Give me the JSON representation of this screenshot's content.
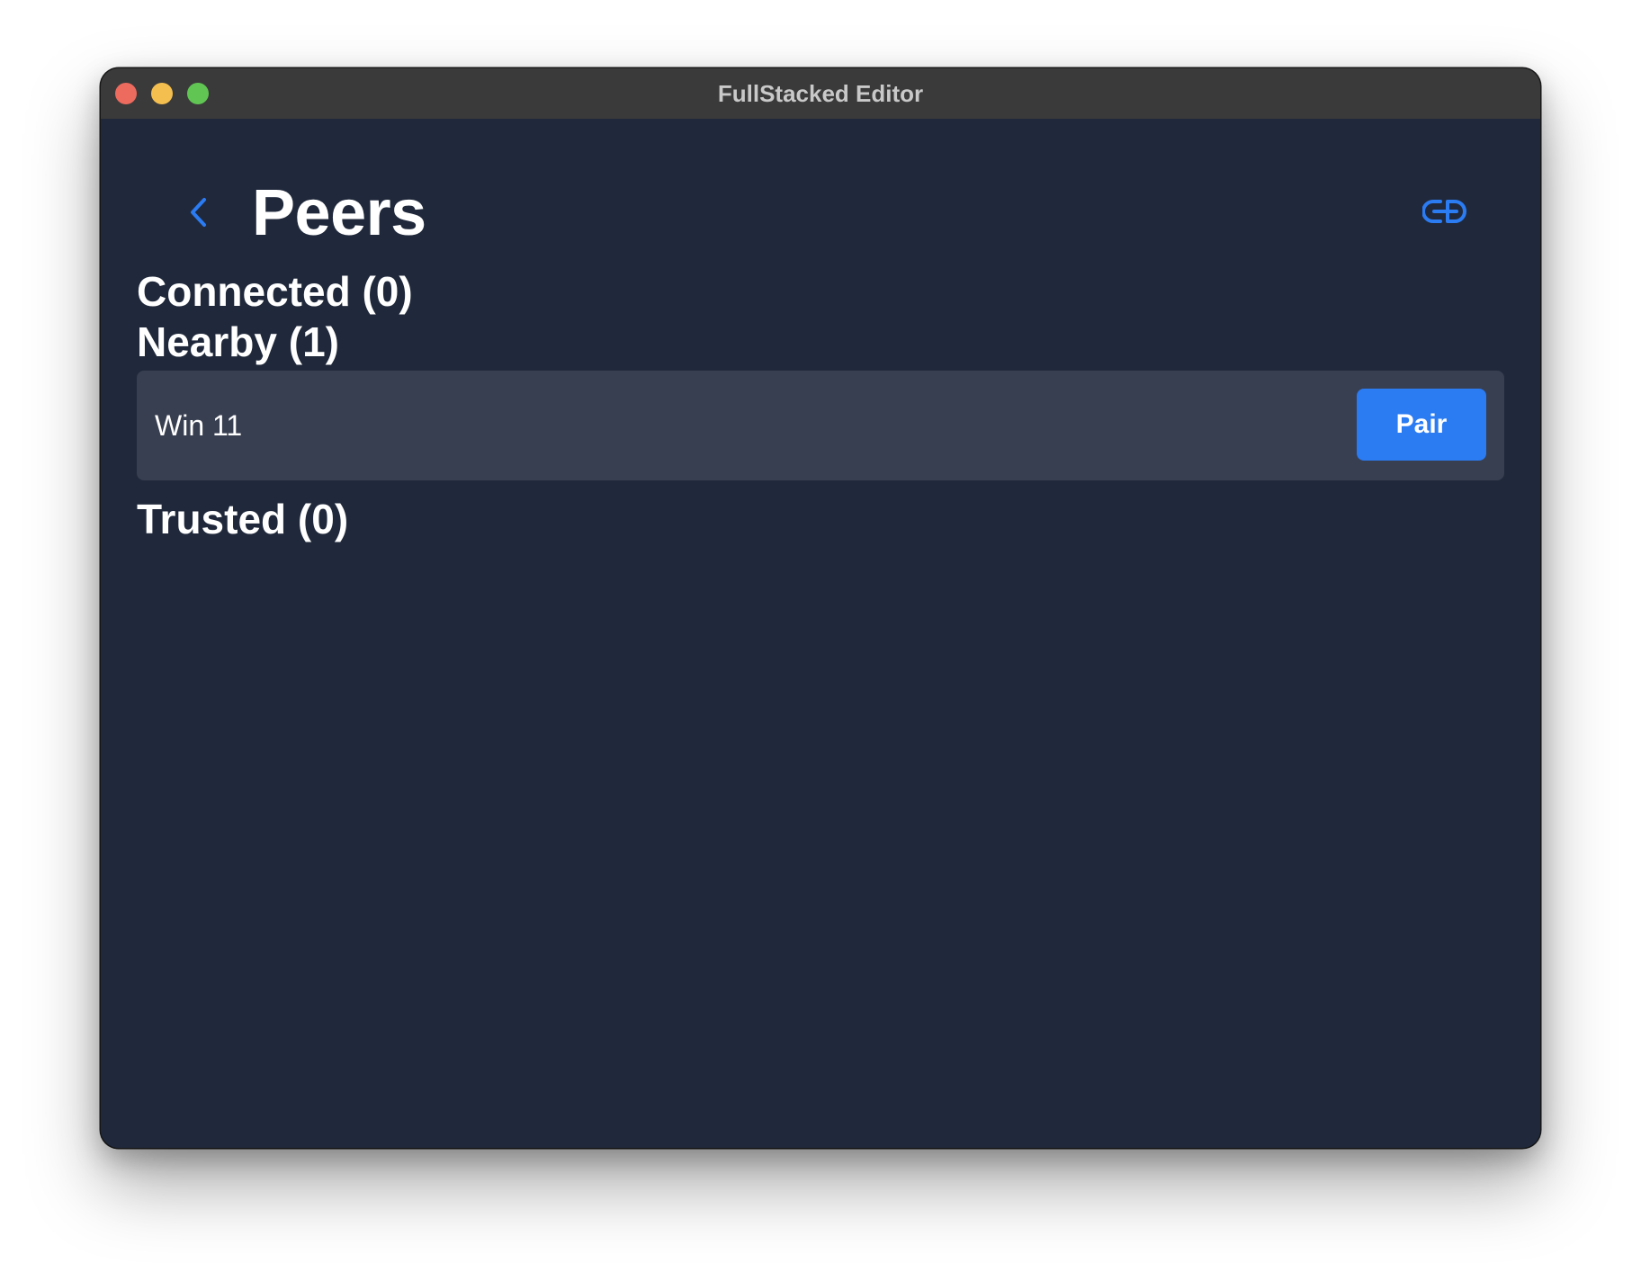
{
  "window": {
    "title": "FullStacked Editor"
  },
  "header": {
    "back_icon": "chevron-left-icon",
    "title": "Peers",
    "action_icon": "link-icon"
  },
  "sections": {
    "connected": {
      "heading": "Connected (0)"
    },
    "nearby": {
      "heading": "Nearby (1)",
      "peers": [
        {
          "name": "Win 11",
          "action_label": "Pair"
        }
      ]
    },
    "trusted": {
      "heading": "Trusted (0)"
    }
  },
  "colors": {
    "background": "#20293b",
    "row_background": "#383f50",
    "accent": "#2b7bf3",
    "titlebar": "#3a3a3a"
  }
}
